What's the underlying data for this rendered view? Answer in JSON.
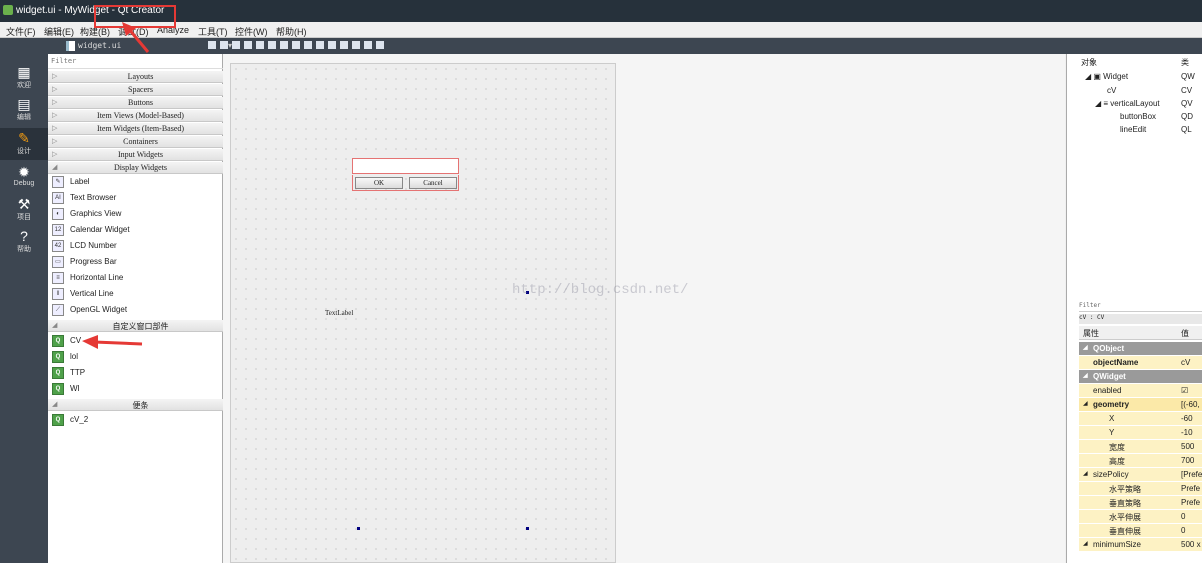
{
  "window": {
    "title": "widget.ui - MyWidget - Qt Creator"
  },
  "menu": [
    "文件(F)",
    "编辑(E)",
    "构建(B)",
    "调试(D)",
    "Analyze",
    "工具(T)",
    "控件(W)",
    "帮助(H)"
  ],
  "toolbar": {
    "file_name": "widget.ui",
    "dropdown_glyph": "▾"
  },
  "modes": [
    {
      "label": "欢迎",
      "icon": "grid-icon",
      "glyph": "▦"
    },
    {
      "label": "编辑",
      "icon": "edit-icon",
      "glyph": "▤"
    },
    {
      "label": "设计",
      "icon": "design-icon",
      "glyph": "✎"
    },
    {
      "label": "Debug",
      "icon": "bug-icon",
      "glyph": "✹"
    },
    {
      "label": "项目",
      "icon": "wrench-icon",
      "glyph": "⚒"
    },
    {
      "label": "帮助",
      "icon": "help-icon",
      "glyph": "?"
    }
  ],
  "widgetbox": {
    "filter": "Filter",
    "categories": [
      "Layouts",
      "Spacers",
      "Buttons",
      "Item Views (Model-Based)",
      "Item Widgets (Item-Based)",
      "Containers",
      "Input Widgets",
      "Display Widgets"
    ],
    "display_items": [
      "Label",
      "Text Browser",
      "Graphics View",
      "Calendar Widget",
      "LCD Number",
      "Progress Bar",
      "Horizontal Line",
      "Vertical Line",
      "OpenGL Widget"
    ],
    "custom_category": "自定义窗口部件",
    "custom_items": [
      "CV",
      "lol",
      "TTP",
      "WI"
    ],
    "scratch_category": "便条",
    "scratch_items": [
      "cV_2"
    ]
  },
  "form": {
    "ok": "OK",
    "cancel": "Cancel",
    "textlabel": "TextLabel",
    "watermark": "http://blog.csdn.net/"
  },
  "objects": {
    "header_obj": "对象",
    "header_class": "类",
    "rows": [
      {
        "name": "Widget",
        "cls": "QW"
      },
      {
        "name": "cV",
        "cls": "CV"
      },
      {
        "name": "verticalLayout",
        "cls": "QV"
      },
      {
        "name": "buttonBox",
        "cls": "QD"
      },
      {
        "name": "lineEdit",
        "cls": "QL"
      }
    ]
  },
  "properties": {
    "filter": "Filter",
    "class_line": "cV : CV",
    "header_prop": "属性",
    "header_val": "值",
    "rows": [
      {
        "k": "QObject",
        "v": "",
        "type": "sec"
      },
      {
        "k": "objectName",
        "v": "cV",
        "type": "yel"
      },
      {
        "k": "QWidget",
        "v": "",
        "type": "sec"
      },
      {
        "k": "enabled",
        "v": "☑",
        "type": "yel"
      },
      {
        "k": "geometry",
        "v": "[(-60,",
        "type": "yel2"
      },
      {
        "k": "X",
        "v": "-60",
        "type": "yel sub"
      },
      {
        "k": "Y",
        "v": "-10",
        "type": "yel sub"
      },
      {
        "k": "宽度",
        "v": "500",
        "type": "yel sub"
      },
      {
        "k": "高度",
        "v": "700",
        "type": "yel sub"
      },
      {
        "k": "sizePolicy",
        "v": "[Prefe",
        "type": "yel"
      },
      {
        "k": "水平策略",
        "v": "Prefe",
        "type": "yel sub"
      },
      {
        "k": "垂直策略",
        "v": "Prefe",
        "type": "yel sub"
      },
      {
        "k": "水平伸展",
        "v": "0",
        "type": "yel sub"
      },
      {
        "k": "垂直伸展",
        "v": "0",
        "type": "yel sub"
      },
      {
        "k": "minimumSize",
        "v": "500 x",
        "type": "yel"
      }
    ]
  },
  "colors": {
    "annotation": "#e53935",
    "dark": "#3d4651",
    "section": "#9a9a9a"
  }
}
